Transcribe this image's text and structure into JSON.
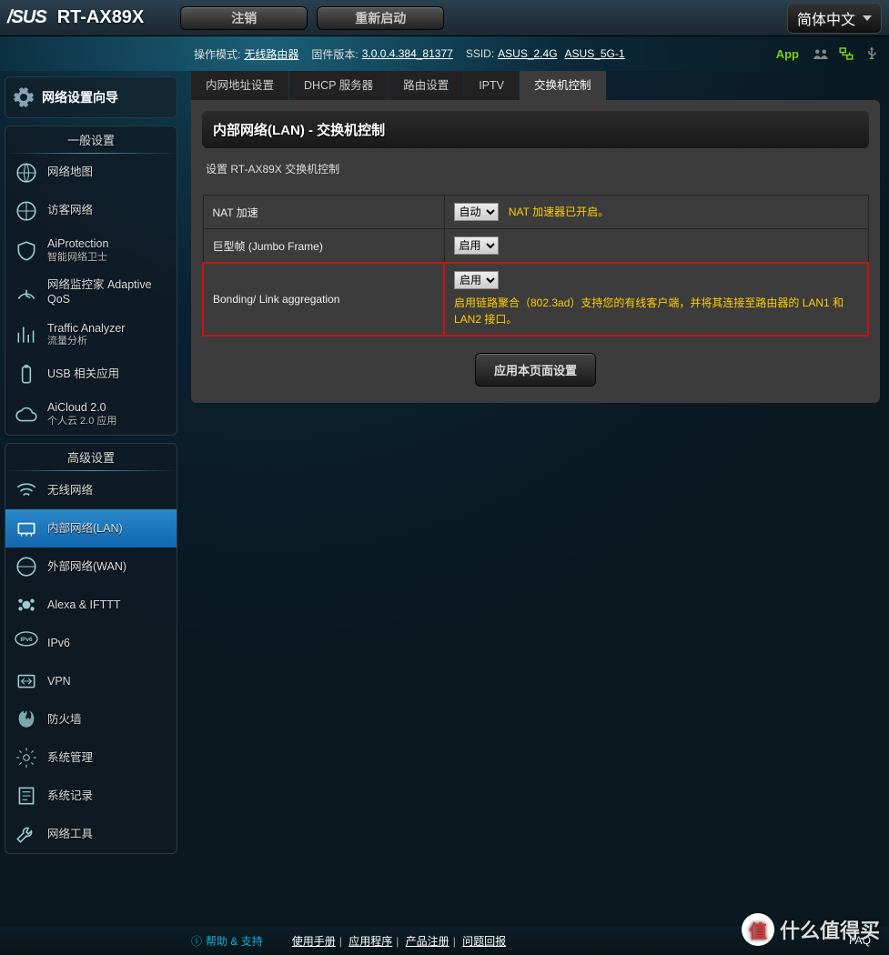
{
  "header": {
    "brand": "/SUS",
    "model": "RT-AX89X",
    "logout": "注销",
    "reboot": "重新启动",
    "lang": "简体中文"
  },
  "statusbar": {
    "mode_label": "操作模式:",
    "mode": "无线路由器",
    "fw_label": "固件版本:",
    "fw": "3.0.0.4.384_81377",
    "ssid_label": "SSID:",
    "ssid1": "ASUS_2.4G",
    "ssid2": "ASUS_5G-1",
    "app": "App"
  },
  "sidebar": {
    "wizard": "网络设置向导",
    "general_hdr": "一般设置",
    "general": [
      {
        "label": "网络地图"
      },
      {
        "label": "访客网络"
      },
      {
        "label": "AiProtection",
        "sub": "智能网络卫士"
      },
      {
        "label": "网络监控家 Adaptive QoS"
      },
      {
        "label": "Traffic Analyzer",
        "sub": "流量分析"
      },
      {
        "label": "USB 相关应用"
      },
      {
        "label": "AiCloud 2.0",
        "sub": "个人云 2.0 应用"
      }
    ],
    "advanced_hdr": "高级设置",
    "advanced": [
      {
        "label": "无线网络"
      },
      {
        "label": "内部网络(LAN)"
      },
      {
        "label": "外部网络(WAN)"
      },
      {
        "label": "Alexa & IFTTT"
      },
      {
        "label": "IPv6"
      },
      {
        "label": "VPN"
      },
      {
        "label": "防火墙"
      },
      {
        "label": "系统管理"
      },
      {
        "label": "系统记录"
      },
      {
        "label": "网络工具"
      }
    ]
  },
  "tabs": [
    "内网地址设置",
    "DHCP 服务器",
    "路由设置",
    "IPTV",
    "交换机控制"
  ],
  "panel": {
    "title": "内部网络(LAN) - 交换机控制",
    "desc": "设置 RT-AX89X 交换机控制",
    "rows": {
      "nat_label": "NAT 加速",
      "nat_value": "自动",
      "nat_hint": "NAT 加速器已开启。",
      "jumbo_label": "巨型帧 (Jumbo Frame)",
      "jumbo_value": "启用",
      "bond_label": "Bonding/ Link aggregation",
      "bond_value": "启用",
      "bond_hint": "启用链路聚合（802.3ad）支持您的有线客户端，并将其连接至路由器的 LAN1 和 LAN2 接口。"
    },
    "apply": "应用本页面设置"
  },
  "footer": {
    "help": "帮助 & 支持",
    "links": [
      "使用手册",
      "应用程序",
      "产品注册",
      "问题回报"
    ],
    "faq": "FAQ"
  },
  "watermark": "什么值得买"
}
